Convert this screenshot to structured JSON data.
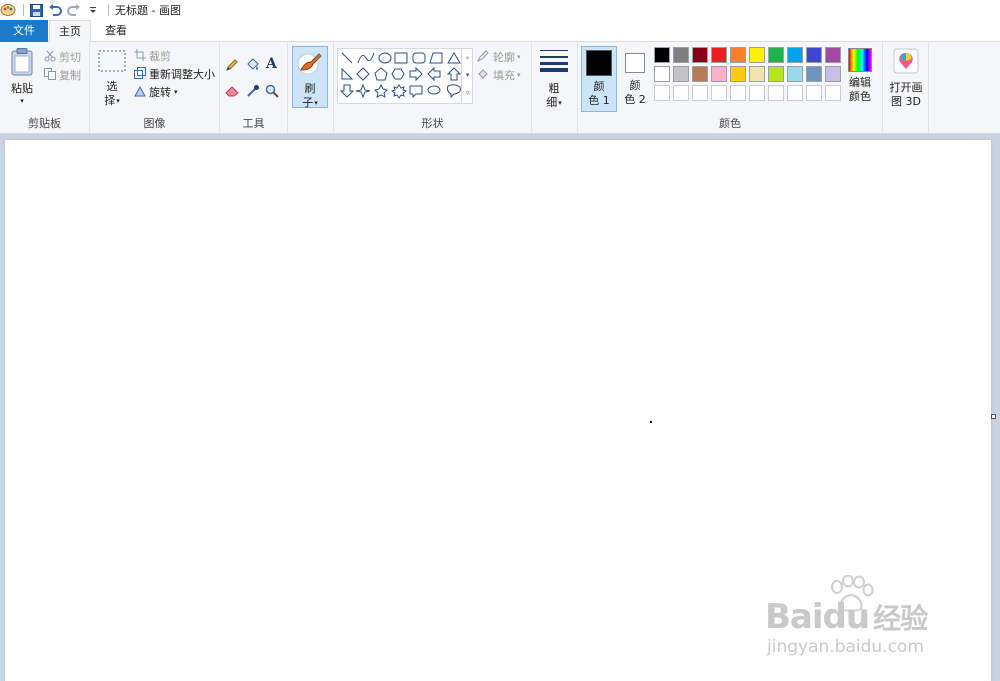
{
  "window": {
    "title": "无标题 - 画图"
  },
  "tabs": {
    "file": "文件",
    "home": "主页",
    "view": "查看"
  },
  "clipboard": {
    "paste": "粘贴",
    "cut": "剪切",
    "copy": "复制",
    "label": "剪贴板"
  },
  "image": {
    "select_top": "选",
    "select_bottom": "择",
    "crop": "裁剪",
    "resize": "重新调整大小",
    "rotate": "旋转",
    "label": "图像"
  },
  "tools": {
    "label": "工具"
  },
  "brushes": {
    "top": "刷",
    "bottom": "子"
  },
  "shapes": {
    "outline": "轮廓",
    "fill": "填充",
    "label": "形状"
  },
  "size": {
    "top": "粗",
    "bottom": "细"
  },
  "colors": {
    "color1_top": "颜",
    "color1_bottom": "色 1",
    "color2_top": "颜",
    "color2_bottom": "色 2",
    "edit_top": "编辑",
    "edit_bottom": "颜色",
    "label": "颜色",
    "color1": "#000000",
    "color2": "#ffffff",
    "palette_row1": [
      "#000000",
      "#7f7f7f",
      "#880015",
      "#ed1c24",
      "#ff7f27",
      "#fff200",
      "#22b14c",
      "#00a2e8",
      "#3f48cc",
      "#a349a4"
    ],
    "palette_row2": [
      "#ffffff",
      "#c3c3c3",
      "#b97a57",
      "#ffaec9",
      "#ffc90e",
      "#efe4b0",
      "#b5e61d",
      "#99d9ea",
      "#7092be",
      "#c8bfe7"
    ]
  },
  "paint3d": {
    "top": "打开画",
    "bottom": "图 3D"
  },
  "watermark": {
    "brand": "Baidu",
    "brand_cn": "经验",
    "url": "jingyan.baidu.com"
  }
}
